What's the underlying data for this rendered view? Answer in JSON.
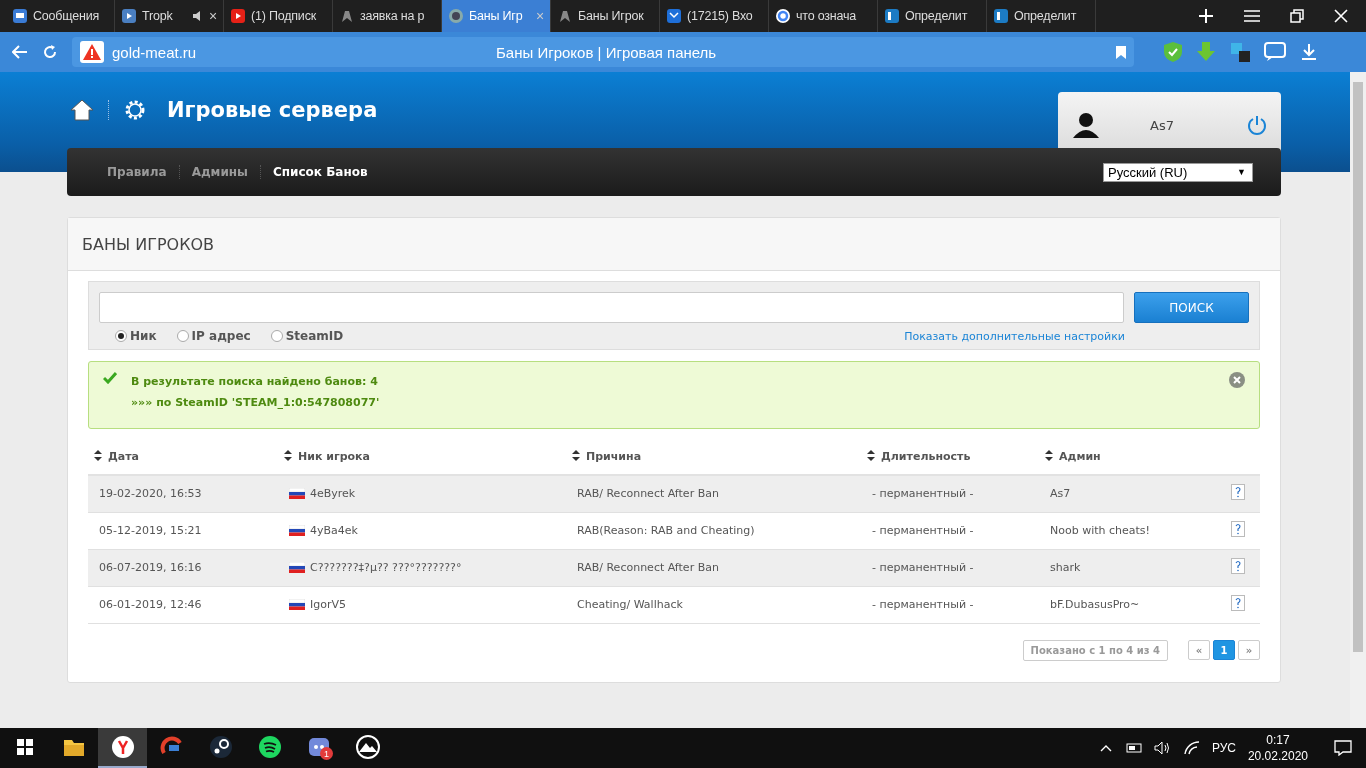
{
  "browser": {
    "tabs": [
      {
        "title": "Сообщения",
        "kind": "chat",
        "selected": false
      },
      {
        "title": "Tropk",
        "kind": "video",
        "selected": false,
        "audio": true,
        "close": "×"
      },
      {
        "title": "(1) Подписк",
        "kind": "youtube",
        "selected": false
      },
      {
        "title": "заявка на р",
        "kind": "ghost",
        "selected": false
      },
      {
        "title": "Баны Игр",
        "kind": "globe",
        "selected": true,
        "close": "×"
      },
      {
        "title": "Баны Игрок",
        "kind": "ghost",
        "selected": false
      },
      {
        "title": "(17215) Вхо",
        "kind": "mail",
        "selected": false
      },
      {
        "title": "что означа",
        "kind": "google",
        "selected": false
      },
      {
        "title": "Определит",
        "kind": "ip",
        "selected": false
      },
      {
        "title": "Определит",
        "kind": "ip",
        "selected": false
      }
    ],
    "address": "gold-meat.ru",
    "page_title": "Баны Игроков | Игровая панель"
  },
  "site": {
    "title": "Игровые сервера",
    "user": "As7",
    "nav": [
      {
        "label": "Правила",
        "selected": false
      },
      {
        "label": "Админы",
        "selected": false
      },
      {
        "label": "Список Банов",
        "selected": true
      }
    ],
    "language": "Русский (RU)",
    "language_caret": "▼"
  },
  "panel": {
    "title": "БАНЫ ИГРОКОВ",
    "search": {
      "button": "ПОИСК",
      "modes": [
        {
          "label": "Ник",
          "selected": true
        },
        {
          "label": "IP адрес",
          "selected": false
        },
        {
          "label": "SteamID",
          "selected": false
        }
      ],
      "more_link": "Показать дополнительные настройки"
    },
    "alert": {
      "lines": [
        "В результате поиска найдено банов: 4",
        "»»» по SteamID 'STEAM_1:0:547808077'"
      ]
    },
    "table": {
      "columns": [
        "Дата",
        "Ник игрока",
        "Причина",
        "Длительность",
        "Админ"
      ],
      "rows": [
        {
          "date": "19-02-2020, 16:53",
          "nick": "4eByrek",
          "reason": "RAB/ Reconnect After Ban",
          "duration": "- перманентный -",
          "admin": "As7"
        },
        {
          "date": "05-12-2019, 15:21",
          "nick": "4yBa4ek",
          "reason": "RAB(Reason: RAB and Cheating)",
          "duration": "- перманентный -",
          "admin": "Noob with cheats!"
        },
        {
          "date": "06-07-2019, 16:16",
          "nick": "C???????‡?µ?? ???°???????°",
          "reason": "RAB/ Reconnect After Ban",
          "duration": "- перманентный -",
          "admin": "shark"
        },
        {
          "date": "06-01-2019, 12:46",
          "nick": "IgorV5",
          "reason": "Cheating/ Wallhack",
          "duration": "- перманентный -",
          "admin": "bF.DubasusPro~"
        }
      ]
    },
    "pagination": {
      "info": "Показано с 1 по 4 из 4",
      "prev": "«",
      "pages": [
        {
          "label": "1",
          "selected": true
        }
      ],
      "next": "»"
    }
  },
  "taskbar": {
    "apps": [
      {
        "kind": "folder",
        "selected": false
      },
      {
        "kind": "yandex",
        "selected": true
      },
      {
        "kind": "cleaner",
        "selected": false
      },
      {
        "kind": "steam",
        "selected": false
      },
      {
        "kind": "spotify",
        "selected": false
      },
      {
        "kind": "discord",
        "selected": false,
        "badge": "1"
      },
      {
        "kind": "mountain",
        "selected": false
      }
    ],
    "tray": {
      "language": "РУС",
      "time": "0:17",
      "date": "20.02.2020"
    }
  }
}
